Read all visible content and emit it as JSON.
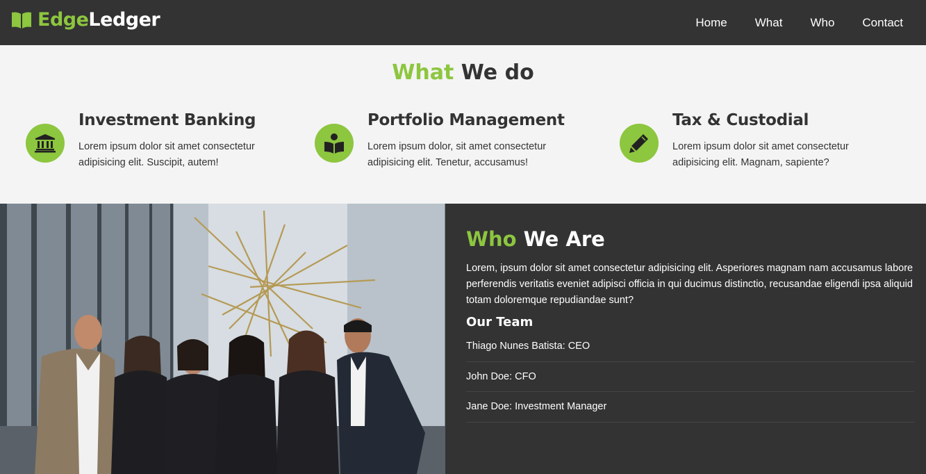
{
  "brand": {
    "accent": "Edge",
    "rest": "Ledger",
    "icon": "book-open-icon"
  },
  "nav": {
    "items": [
      "Home",
      "What",
      "Who",
      "Contact"
    ]
  },
  "what": {
    "title_accent": "What",
    "title_rest": " We do",
    "services": [
      {
        "title": "Investment Banking",
        "text": "Lorem ipsum dolor sit amet consectetur adipisicing elit. Suscipit, autem!",
        "icon": "university-icon"
      },
      {
        "title": "Portfolio Management",
        "text": "Lorem ipsum dolor, sit amet consectetur adipisicing elit. Tenetur, accusamus!",
        "icon": "book-reader-icon"
      },
      {
        "title": "Tax & Custodial",
        "text": "Lorem ipsum dolor sit amet consectetur adipisicing elit. Magnam, sapiente?",
        "icon": "pencil-icon"
      }
    ]
  },
  "who": {
    "title_accent": "Who",
    "title_rest": " We Are",
    "text": "Lorem, ipsum dolor sit amet consectetur adipisicing elit. Asperiores magnam nam accusamus labore perferendis veritatis eveniet adipisci officia in qui ducimus distinctio, recusandae eligendi ipsa aliquid totam doloremque repudiandae sunt?",
    "team_title": "Our Team",
    "team": [
      "Thiago Nunes Batista: CEO",
      "John Doe: CFO",
      "Jane Doe: Investment Manager"
    ]
  },
  "colors": {
    "accent": "#8dc63f",
    "dark": "#333333",
    "light_bg": "#f4f4f4"
  }
}
